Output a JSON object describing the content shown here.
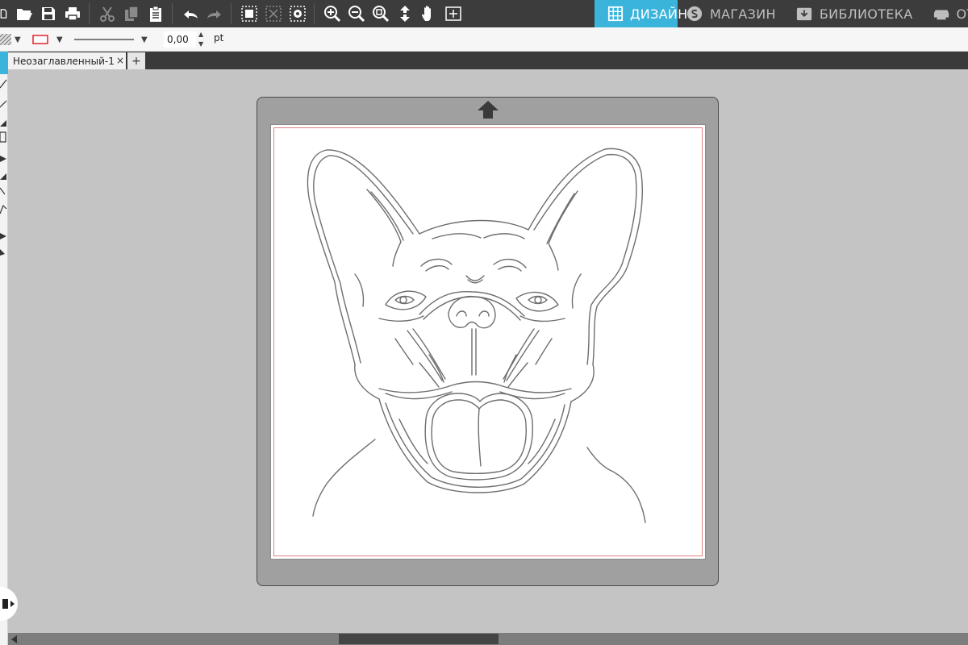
{
  "toolbar": {
    "icons": [
      "new-document-icon",
      "open-folder-icon",
      "save-icon",
      "print-icon",
      "cut-icon",
      "copy-icon",
      "paste-icon",
      "undo-icon",
      "redo-icon",
      "group-icon",
      "ungroup-icon",
      "select-all-icon",
      "zoom-in-icon",
      "zoom-out-icon",
      "zoom-fit-icon",
      "move-down-icon",
      "pan-hand-icon",
      "fit-page-icon"
    ]
  },
  "nav_tabs": [
    {
      "label": "ДИЗАЙН",
      "active": true,
      "icon": "grid-icon"
    },
    {
      "label": "МАГАЗИН",
      "active": false,
      "icon": "store-s-icon"
    },
    {
      "label": "БИБЛИОТЕКА",
      "active": false,
      "icon": "library-download-icon"
    },
    {
      "label": "ОТПРА",
      "active": false,
      "icon": "send-plotter-icon"
    }
  ],
  "properties": {
    "line_width": "0,00",
    "unit": "pt",
    "line_color": "#e0202e"
  },
  "document_tabs": {
    "title": "Неозаглавленный-1",
    "close": "×",
    "add": "+"
  },
  "colors": {
    "accent": "#3bb4dc",
    "toolbar_bg": "#3c3c3c",
    "canvas_bg": "#c4c4c4",
    "mat": "#a0a0a0",
    "cut_border": "#e08080"
  }
}
